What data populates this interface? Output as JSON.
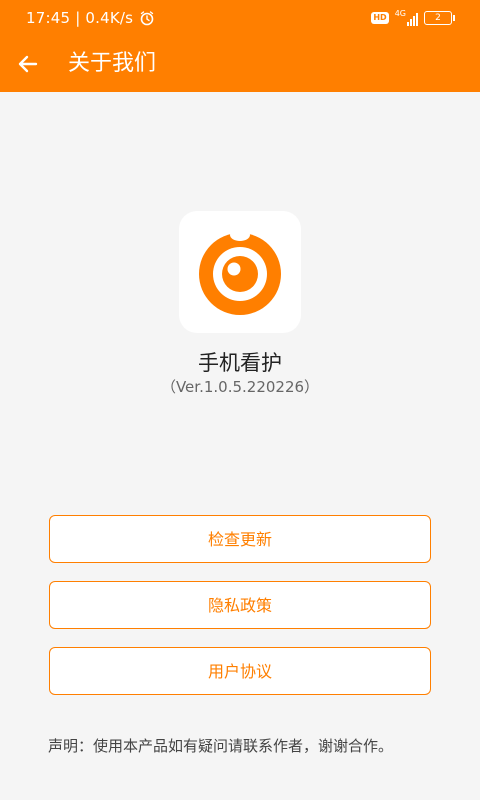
{
  "status_bar": {
    "time_speed": "17:45 | 0.4K/s",
    "hd": "HD",
    "network": "4G",
    "battery": "2"
  },
  "app_bar": {
    "title": "关于我们",
    "back_icon": "arrow-left-icon"
  },
  "app_info": {
    "logo_icon": "camera-eye-logo",
    "name": "手机看护",
    "version": "（Ver.1.0.5.220226）"
  },
  "buttons": [
    {
      "label": "检查更新"
    },
    {
      "label": "隐私政策"
    },
    {
      "label": "用户协议"
    }
  ],
  "disclaimer": "声明：使用本产品如有疑问请联系作者，谢谢合作。",
  "colors": {
    "accent": "#ff7f00",
    "background": "#f5f5f5"
  }
}
